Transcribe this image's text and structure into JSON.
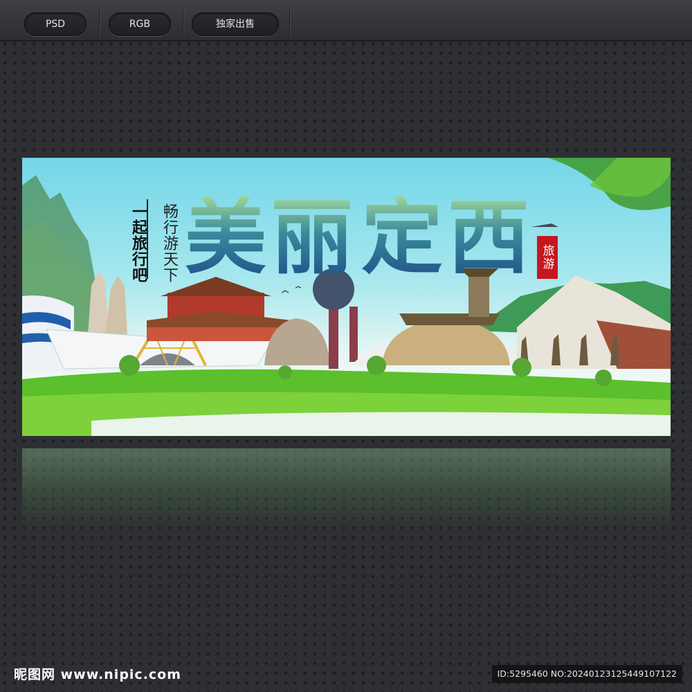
{
  "toolbar": {
    "buttons": [
      {
        "label": "PSD"
      },
      {
        "label": "RGB"
      },
      {
        "label": "独家出售"
      }
    ]
  },
  "banner": {
    "title_chars": [
      "美",
      "丽",
      "定",
      "西"
    ],
    "slogan_left": "一起旅行吧",
    "slogan_right": "畅行游天下",
    "seal_text": "旅游",
    "colors": {
      "sky_top": "#73d6e8",
      "grass": "#5cbf2c",
      "title_dark": "#1d4f8a",
      "seal_red": "#c7161d"
    }
  },
  "footer": {
    "logo": "昵图网 www.nipic.com",
    "image_id": "ID:5295460 NO:20240123125449107122"
  }
}
